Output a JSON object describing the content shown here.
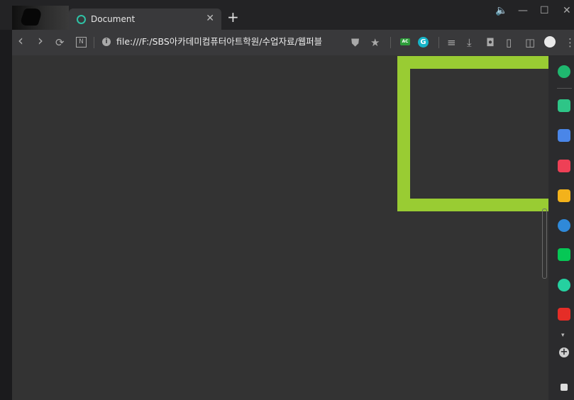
{
  "browser": {
    "tab": {
      "title": "Document",
      "close_glyph": "✕"
    },
    "new_tab_glyph": "+",
    "window_controls": {
      "speaker": "🔈",
      "minimize": "—",
      "maximize": "☐",
      "close": "✕"
    }
  },
  "toolbar": {
    "back_glyph": "‹",
    "forward_glyph": "›",
    "reload_glyph": "⟳",
    "n_icon_label": "N",
    "info_glyph": "i",
    "url": "file:///F:/SBS아카데미컴퓨터아트학원/수업자료/웹퍼블",
    "ac_label": "AC",
    "g_label": "G",
    "shield_glyph": "⛊",
    "star_glyph": "★",
    "queue_glyph": "≡",
    "download_glyph": "⤓",
    "camera_glyph": "◘",
    "reader_glyph": "▯",
    "sidebar_glyph": "◫",
    "menu_glyph": "⋮"
  },
  "page": {
    "background": "#333333",
    "box_color": "#99cc33"
  },
  "sidebar": {
    "icons": [
      {
        "name": "whale-icon",
        "color": "#1fb76f"
      },
      {
        "name": "alarm-bell-icon",
        "color": "#2ec587"
      },
      {
        "name": "calendar-icon",
        "color": "#4a86e8"
      },
      {
        "name": "pocket-icon",
        "color": "#ee4056"
      },
      {
        "name": "favorites-icon",
        "color": "#f3b21b"
      },
      {
        "name": "edge-icon",
        "color": "#2f89d9"
      },
      {
        "name": "line-icon",
        "color": "#06c755"
      },
      {
        "name": "play-icon",
        "color": "#25d0a0"
      },
      {
        "name": "youtube-icon",
        "color": "#e52d27"
      }
    ],
    "more_glyph": "▾",
    "add_glyph": "+"
  }
}
